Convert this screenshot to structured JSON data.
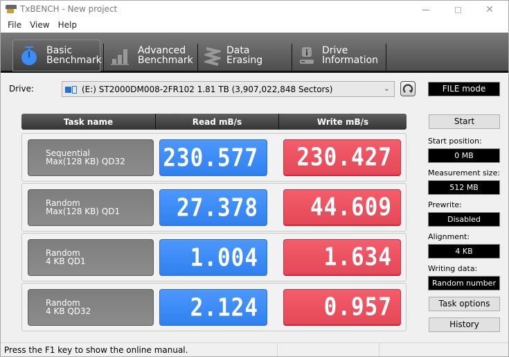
{
  "window": {
    "title": "TxBENCH - New project",
    "controls": {
      "minimize": "minimize",
      "maximize": "maximize",
      "close": "✕"
    }
  },
  "menu": [
    "File",
    "View",
    "Help"
  ],
  "tabs": [
    {
      "line1": "Basic",
      "line2": "Benchmark",
      "icon": "stopwatch-icon",
      "active": true
    },
    {
      "line1": "Advanced",
      "line2": "Benchmark",
      "icon": "bar-chart-icon",
      "active": false
    },
    {
      "line1": "Data Erasing",
      "line2": "",
      "icon": "eraser-icon",
      "active": false
    },
    {
      "line1": "Drive",
      "line2": "Information",
      "icon": "drive-info-icon",
      "active": false
    }
  ],
  "drive": {
    "label": "Drive:",
    "selected": "(E:) ST2000DM008-2FR102  1.81 TB (3,907,022,848 Sectors)",
    "mode": "FILE mode"
  },
  "grid": {
    "headers": [
      "Task name",
      "Read mB/s",
      "Write mB/s"
    ],
    "rows": [
      {
        "name1": "Sequential",
        "name2": "Max(128 KB) QD32",
        "read": "230.577",
        "write": "230.427"
      },
      {
        "name1": "Random",
        "name2": "Max(128 KB) QD1",
        "read": "27.378",
        "write": "44.609"
      },
      {
        "name1": "Random",
        "name2": "4 KB QD1",
        "read": "1.004",
        "write": "1.634"
      },
      {
        "name1": "Random",
        "name2": "4 KB QD32",
        "read": "2.124",
        "write": "0.957"
      }
    ]
  },
  "panel": {
    "start": "Start",
    "start_position_label": "Start position:",
    "start_position": "0 MB",
    "measurement_size_label": "Measurement size:",
    "measurement_size": "512 MB",
    "prewrite_label": "Prewrite:",
    "prewrite": "Disabled",
    "alignment_label": "Alignment:",
    "alignment": "4 KB",
    "writing_data_label": "Writing data:",
    "writing_data": "Random number",
    "task_options": "Task options",
    "history": "History"
  },
  "colors": {
    "read": "#3a8cf8",
    "write": "#ea505e",
    "accent": "#3a8cf8"
  },
  "status": {
    "text": "Press the F1 key to show the online manual."
  }
}
